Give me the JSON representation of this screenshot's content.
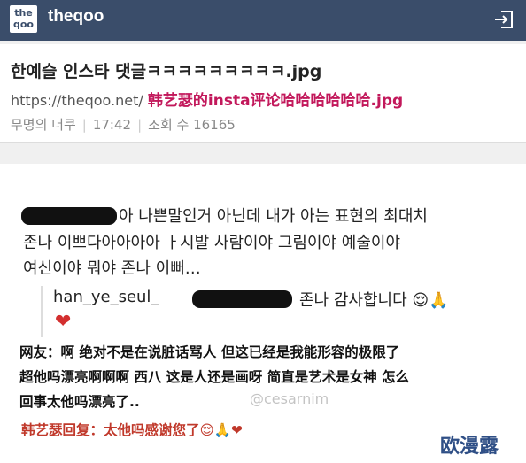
{
  "app": {
    "logo_text_line1": "the",
    "logo_text_line2": "qoo",
    "brand": "theqoo",
    "login_icon": "login-arrow-icon"
  },
  "post": {
    "title": "한예슬 인스타 댓글ㅋㅋㅋㅋㅋㅋㅋㅋㅋ.jpg",
    "url_prefix": "https://theqoo.net/",
    "overlay_title": "韩艺瑟的insta评论哈哈哈哈哈哈.jpg",
    "author": "무명의 더쿠",
    "time": "17:42",
    "views": "조회 수 16165"
  },
  "comment": {
    "line1": "아 나쁜말인거 아닌데 내가 아는 표현의 최대치",
    "line2": "존나 이쁘다아아아아 ㅏ시발 사람이야 그림이야 예술이야",
    "line3": "여신이야 뭐야 존나 이뻐…",
    "reply_user": "han_ye_seul_",
    "reply_text": "존나 감사합니다 😌🙏",
    "reply_heart": "❤"
  },
  "caption": {
    "line1": "网友：啊 绝对不是在说脏话骂人 但这已经是我能形容的极限了",
    "line2": "超他吗漂亮啊啊啊 西八 这是人还是画呀 简直是艺术是女神 怎么",
    "line3": "回事太他吗漂亮了..",
    "reply": "韩艺瑟回复：太他吗感谢您了😌🙏❤"
  },
  "watermark": {
    "user": "@cesarnim",
    "site": "欧漫露"
  },
  "colors": {
    "appbar": "#3a4d6a",
    "overlay_title": "#c2185b",
    "reply_red": "#c0392b"
  }
}
